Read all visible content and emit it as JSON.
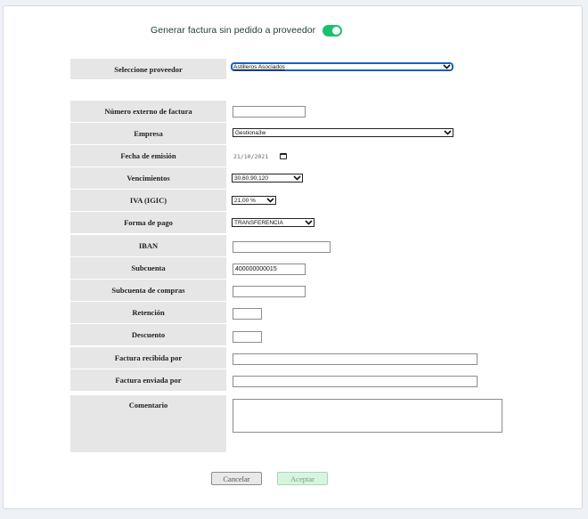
{
  "header": {
    "label": "Generar factura sin pedido a proveedor",
    "toggle_on": true,
    "toggle_color": "#19c26b"
  },
  "proveedor": {
    "label": "Seleccione proveedor",
    "value": "Astilleros Asociados"
  },
  "fields": {
    "numero_externo": {
      "label": "Número externo de factura",
      "value": ""
    },
    "empresa": {
      "label": "Empresa",
      "value": "Gestiona3w"
    },
    "fecha_emision": {
      "label": "Fecha de emisión",
      "value": "21/10/2021"
    },
    "vencimientos": {
      "label": "Vencimientos",
      "value": "30,60,90,120"
    },
    "iva": {
      "label": "IVA (IGIC)",
      "value": "21,00 %"
    },
    "forma_pago": {
      "label": "Forma de pago",
      "value": "TRANSFERENCIA"
    },
    "iban": {
      "label": "IBAN",
      "value": ""
    },
    "subcuenta": {
      "label": "Subcuenta",
      "value": "400000000015"
    },
    "subcuenta_compras": {
      "label": "Subcuenta de compras",
      "value": ""
    },
    "retencion": {
      "label": "Retención",
      "value": ""
    },
    "descuento": {
      "label": "Descuento",
      "value": ""
    },
    "recibida_por": {
      "label": "Factura recibida por",
      "value": ""
    },
    "enviada_por": {
      "label": "Factura enviada por",
      "value": ""
    },
    "comentario": {
      "label": "Comentario",
      "value": ""
    }
  },
  "buttons": {
    "cancel": "Cancelar",
    "accept": "Aceptar"
  },
  "colors": {
    "label_bg": "#e6e6e6",
    "accept_bg": "#d7f5de",
    "focus_border": "#1b5fbf"
  }
}
